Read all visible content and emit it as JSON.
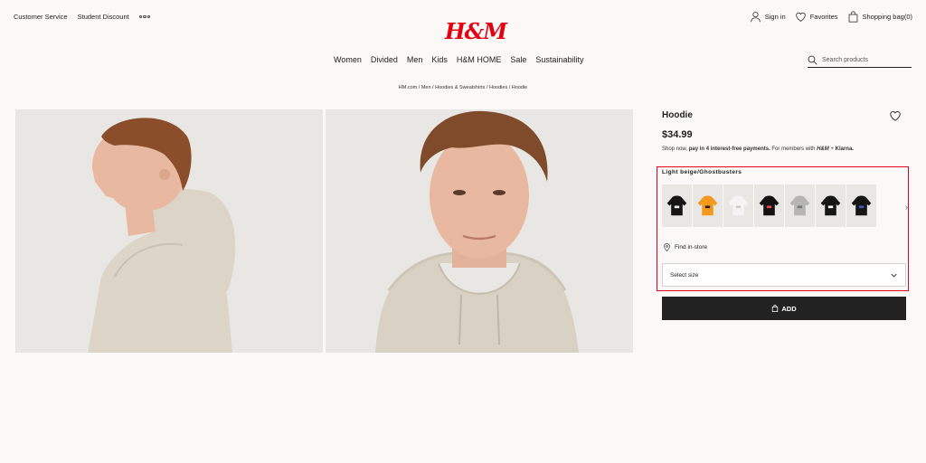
{
  "header": {
    "customer_service": "Customer Service",
    "student_discount": "Student Discount",
    "logo": "H&M",
    "sign_in": "Sign in",
    "favorites": "Favorites",
    "shopping_bag": "Shopping bag(0)"
  },
  "nav": {
    "items": [
      "Women",
      "Divided",
      "Men",
      "Kids",
      "H&M HOME",
      "Sale",
      "Sustainability"
    ],
    "search_placeholder": "Search products"
  },
  "breadcrumb": "HM.com / Men / Hoodies & Sweatshirts / Hoodies / Hoodie",
  "product": {
    "name": "Hoodie",
    "price": "$34.99",
    "klarna_text_1": "Shop now, ",
    "klarna_text_bold": "pay in 4 interest-free payments.",
    "klarna_text_2": " For members with ",
    "klarna_brand_hm": "H&M",
    "klarna_plus": " + ",
    "klarna_brand": "Klarna.",
    "selected_color": "Light beige/Ghostbusters",
    "swatches": [
      {
        "color": "#151515",
        "print": "#eee"
      },
      {
        "color": "#f39a1e",
        "print": "#222"
      },
      {
        "color": "#f4f4f4",
        "print": "#ccc"
      },
      {
        "color": "#121212",
        "print": "#e44"
      },
      {
        "color": "#b5b5b5",
        "print": "#777"
      },
      {
        "color": "#161616",
        "print": "#fff"
      },
      {
        "color": "#151515",
        "print": "#3a5bbb"
      }
    ],
    "find_in_store": "Find in-store",
    "select_size": "Select size",
    "add_label": "ADD"
  },
  "colors": {
    "brand_red": "#e50010",
    "highlight_red": "#e5001f",
    "add_button_bg": "#222222"
  }
}
